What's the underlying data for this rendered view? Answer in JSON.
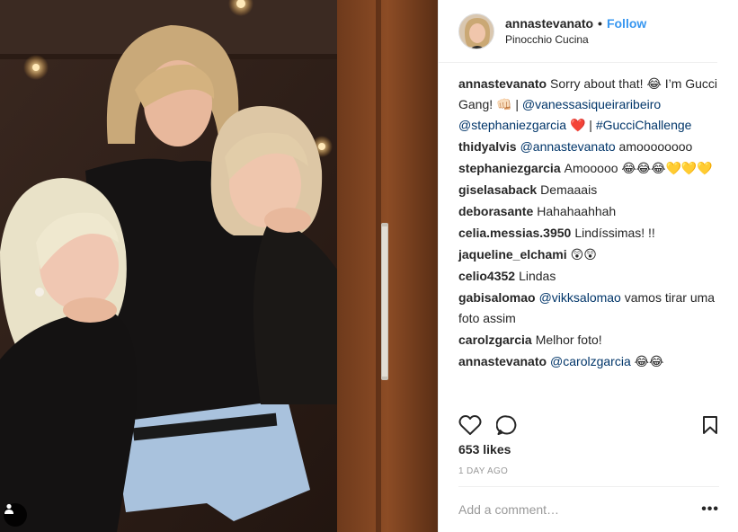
{
  "post": {
    "author": "annastevanato",
    "follow_label": "Follow",
    "location": "Pinocchio Cucina",
    "likes": "653 likes",
    "time_ago": "1 DAY AGO",
    "add_comment_placeholder": "Add a comment…",
    "more_label": "•••"
  },
  "comments": [
    {
      "user": "annastevanato",
      "parts": [
        {
          "t": "Sorry about that! 😂 I’m Gucci Gang! 👊🏻 | "
        },
        {
          "t": "@vanessasiqueiraribeiro",
          "link": true
        },
        {
          "t": " "
        },
        {
          "t": "@stephaniezgarcia",
          "link": true
        },
        {
          "t": " ❤️ | "
        },
        {
          "t": "#GucciChallenge",
          "link": true
        }
      ]
    },
    {
      "user": "thidyalvis",
      "parts": [
        {
          "t": "@annastevanato",
          "link": true
        },
        {
          "t": " amoooooooo"
        }
      ]
    },
    {
      "user": "stephaniezgarcia",
      "parts": [
        {
          "t": "Amooooo 😂😂😂💛💛💛"
        }
      ]
    },
    {
      "user": "giselasaback",
      "parts": [
        {
          "t": "Demaaais"
        }
      ]
    },
    {
      "user": "deborasante",
      "parts": [
        {
          "t": "Hahahaahhah"
        }
      ]
    },
    {
      "user": "celia.messias.3950",
      "parts": [
        {
          "t": "Lindíssimas! !!"
        }
      ]
    },
    {
      "user": "jaqueline_elchami",
      "parts": [
        {
          "t": "😲😲"
        }
      ]
    },
    {
      "user": "celio4352",
      "parts": [
        {
          "t": "Lindas"
        }
      ]
    },
    {
      "user": "gabisalomao",
      "parts": [
        {
          "t": "@vikksalomao",
          "link": true
        },
        {
          "t": " vamos tirar uma foto assim"
        }
      ]
    },
    {
      "user": "carolzgarcia",
      "parts": [
        {
          "t": "Melhor foto!"
        }
      ]
    },
    {
      "user": "annastevanato",
      "parts": [
        {
          "t": "@carolzgarcia",
          "link": true
        },
        {
          "t": " 😂😂"
        }
      ]
    }
  ],
  "icons": {
    "like": "heart-outline-icon",
    "comment": "speech-bubble-icon",
    "save": "bookmark-icon",
    "tagged_people": "person-icon"
  },
  "colors": {
    "link": "#003569",
    "follow": "#3897f0",
    "muted": "#999999",
    "border": "#efefef"
  }
}
